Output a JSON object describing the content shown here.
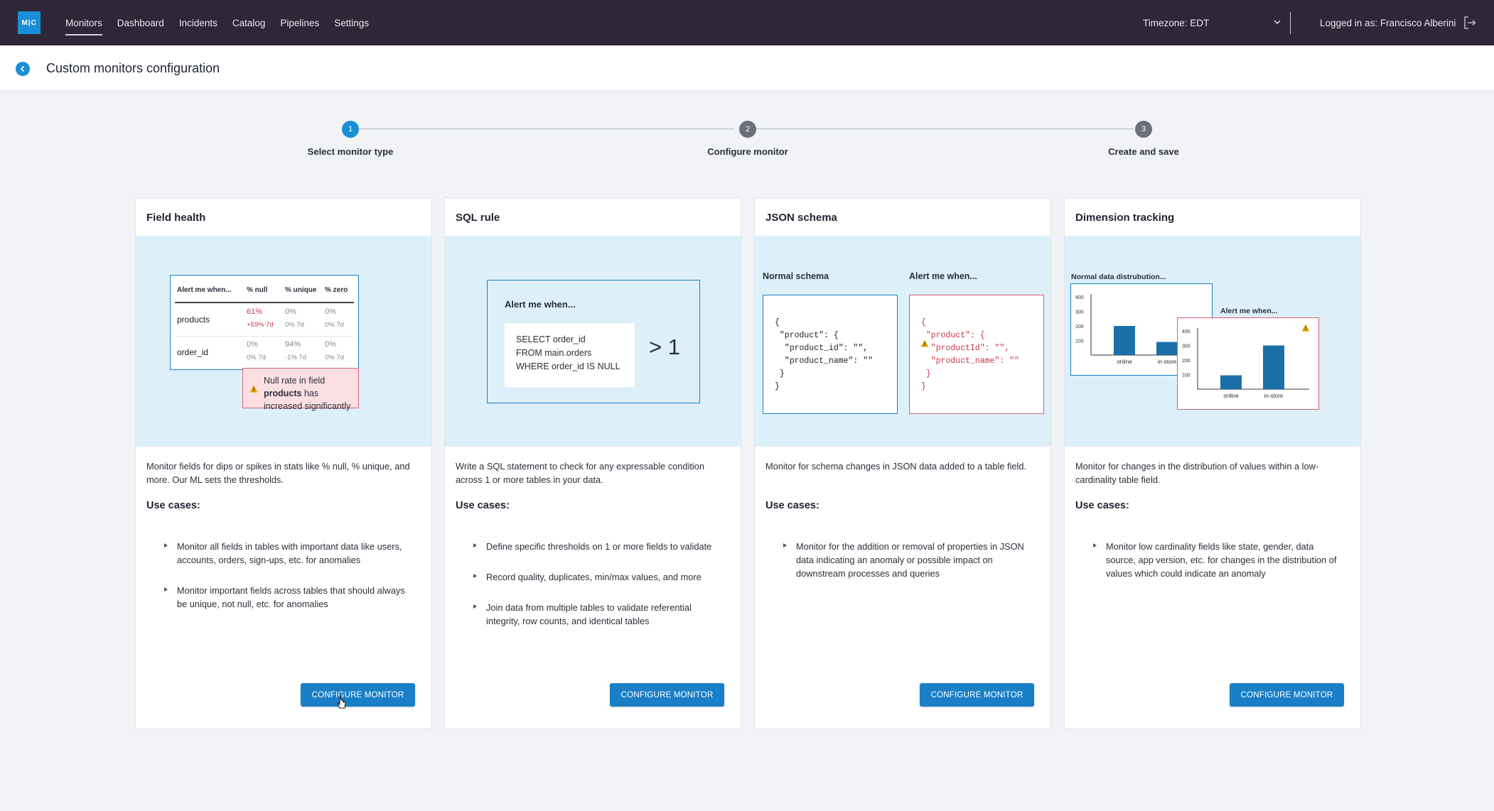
{
  "app": {
    "logo_text": "M|C",
    "nav": [
      {
        "label": "Monitors",
        "active": true
      },
      {
        "label": "Dashboard",
        "active": false
      },
      {
        "label": "Incidents",
        "active": false
      },
      {
        "label": "Catalog",
        "active": false
      },
      {
        "label": "Pipelines",
        "active": false
      },
      {
        "label": "Settings",
        "active": false
      }
    ],
    "timezone": "Timezone: EDT",
    "user": "Logged in as: Francisco Alberini"
  },
  "header": {
    "title": "Custom monitors configuration"
  },
  "stepper": {
    "steps": [
      {
        "number": "1",
        "label": "Select monitor type",
        "active": true
      },
      {
        "number": "2",
        "label": "Configure monitor",
        "active": false
      },
      {
        "number": "3",
        "label": "Create and save",
        "active": false
      }
    ]
  },
  "cards": [
    {
      "title": "Field health",
      "description": "Monitor fields for dips or spikes in stats like % null, % unique, and more. Our ML sets the thresholds.",
      "use_cases_title": "Use cases:",
      "use_cases": [
        "Monitor all fields in tables with important data like users, accounts, orders, sign-ups, etc. for anomalies",
        "Monitor important fields across tables that should always be unique, not null, etc. for anomalies"
      ],
      "button": "CONFIGURE MONITOR",
      "illustration": {
        "headers": [
          "Alert me when...",
          "% null",
          "% unique",
          "% zero"
        ],
        "rows": [
          {
            "field": "products",
            "null": "61%",
            "null_sub": "+59% 7d",
            "unique": "0%",
            "unique_sub": "0% 7d",
            "zero": "0%",
            "zero_sub": "0% 7d"
          },
          {
            "field": "order_id",
            "null": "0%",
            "null_sub": "0% 7d",
            "unique": "94%",
            "unique_sub": "-1% 7d",
            "zero": "0%",
            "zero_sub": "0% 7d"
          }
        ],
        "alert_pre": "Null rate in field ",
        "alert_bold": "products",
        "alert_post": " has increased significantly"
      }
    },
    {
      "title": "SQL rule",
      "description": "Write a SQL statement to check for any expressable condition across 1 or more tables in your data.",
      "use_cases_title": "Use cases:",
      "use_cases": [
        "Define specific thresholds on 1 or more fields to validate",
        "Record quality, duplicates, min/max values, and more",
        "Join data from multiple tables to validate referential integrity, row counts, and identical tables"
      ],
      "button": "CONFIGURE MONITOR",
      "illustration": {
        "alert": "Alert me when...",
        "code": [
          "SELECT order_id",
          "FROM main.orders",
          "WHERE order_id IS NULL"
        ],
        "comparison": "> 1"
      }
    },
    {
      "title": "JSON schema",
      "description": "Monitor for schema changes in JSON data added to a table field.",
      "use_cases_title": "Use cases:",
      "use_cases": [
        "Monitor for the addition or removal of properties in JSON data indicating an anomaly or possible impact on downstream processes and queries"
      ],
      "button": "CONFIGURE MONITOR",
      "illustration": {
        "normal_label": "Normal schema",
        "alert_label": "Alert me when...",
        "normal_code": "{\n \"product\": {\n  \"product_id\": \"\",\n  \"product_name\": \"\"\n }\n}",
        "alert_code": "{\n \"product\": {\n  \"productId\": \"\",\n  \"product_name\": \"\"\n }\n}"
      }
    },
    {
      "title": "Dimension tracking",
      "description": "Monitor for changes in the distribution of values within a low-cardinality table field.",
      "use_cases_title": "Use cases:",
      "use_cases": [
        "Monitor low cardinality fields like state, gender, data source, app version, etc. for changes in the distribution of values which could indicate an anomaly"
      ],
      "button": "CONFIGURE MONITOR",
      "illustration": {
        "normal_label": "Normal data distrubution...",
        "alert_label": "Alert me when...",
        "y_ticks": [
          "400",
          "300",
          "200",
          "100"
        ],
        "categories": [
          "online",
          "in-store"
        ],
        "normal_values": [
          200,
          90
        ],
        "alert_values": [
          95,
          300
        ],
        "bar_color": "#1a6fa8"
      }
    }
  ]
}
